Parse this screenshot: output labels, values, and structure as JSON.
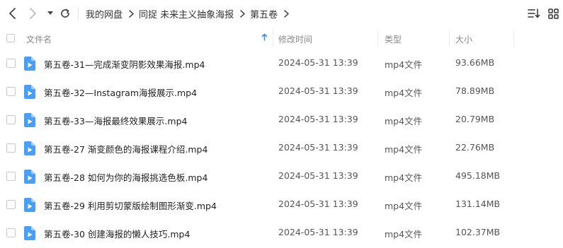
{
  "breadcrumb": [
    "我的网盘",
    "同捉 未来主义抽象海报",
    "第五卷"
  ],
  "header": {
    "name": "文件名",
    "modified": "修改时间",
    "type": "类型",
    "size": "大小"
  },
  "colors": {
    "accent": "#3a8ee6",
    "video_icon": "#4a9ff5"
  },
  "files": [
    {
      "name": "第五卷-31—完成渐变阴影效果海报.mp4",
      "modified": "2024-05-31 13:39",
      "type": "mp4文件",
      "size": "93.66MB",
      "icon": "video-file-icon"
    },
    {
      "name": "第五卷-32—Instagram海报展示.mp4",
      "modified": "2024-05-31 13:39",
      "type": "mp4文件",
      "size": "78.89MB",
      "icon": "video-file-icon"
    },
    {
      "name": "第五卷-33—海报最终效果展示.mp4",
      "modified": "2024-05-31 13:39",
      "type": "mp4文件",
      "size": "20.79MB",
      "icon": "video-file-icon"
    },
    {
      "name": "第五卷-27 渐变颜色的海报课程介绍.mp4",
      "modified": "2024-05-31 13:39",
      "type": "mp4文件",
      "size": "22.76MB",
      "icon": "video-file-icon"
    },
    {
      "name": "第五卷-28 如何为你的海报挑选色板.mp4",
      "modified": "2024-05-31 13:39",
      "type": "mp4文件",
      "size": "495.18MB",
      "icon": "video-file-icon"
    },
    {
      "name": "第五卷-29 利用剪切蒙版绘制图形渐变.mp4",
      "modified": "2024-05-31 13:39",
      "type": "mp4文件",
      "size": "131.14MB",
      "icon": "video-file-icon"
    },
    {
      "name": "第五卷-30 创建海报的懒人技巧.mp4",
      "modified": "2024-05-31 13:39",
      "type": "mp4文件",
      "size": "102.37MB",
      "icon": "video-file-icon"
    }
  ]
}
